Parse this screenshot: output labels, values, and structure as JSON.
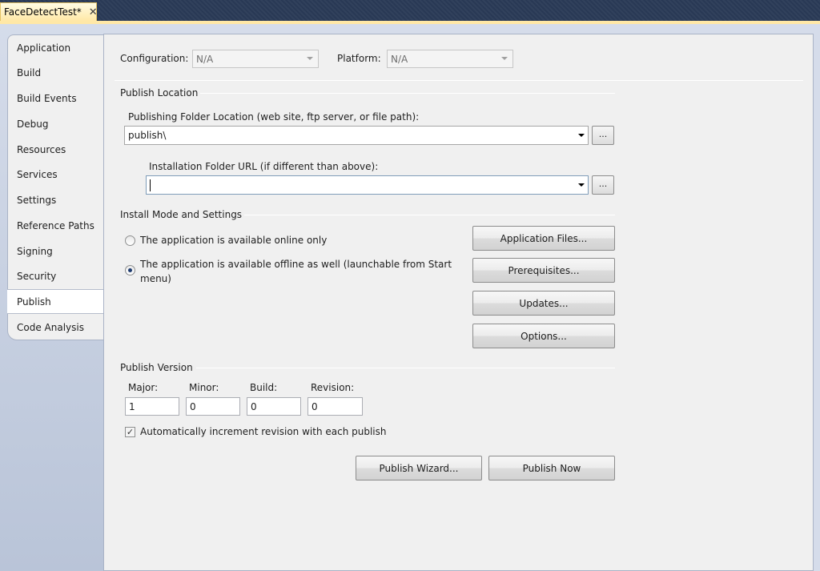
{
  "document_tab": {
    "title": "FaceDetectTest*",
    "close_glyph": "✕"
  },
  "sidebar": {
    "items": [
      {
        "label": "Application"
      },
      {
        "label": "Build"
      },
      {
        "label": "Build Events"
      },
      {
        "label": "Debug"
      },
      {
        "label": "Resources"
      },
      {
        "label": "Services"
      },
      {
        "label": "Settings"
      },
      {
        "label": "Reference Paths"
      },
      {
        "label": "Signing"
      },
      {
        "label": "Security"
      },
      {
        "label": "Publish"
      },
      {
        "label": "Code Analysis"
      }
    ],
    "active": "Publish"
  },
  "config": {
    "configuration_label": "Configuration:",
    "configuration_value": "N/A",
    "platform_label": "Platform:",
    "platform_value": "N/A"
  },
  "publish_location": {
    "title": "Publish Location",
    "folder_label": "Publishing Folder Location (web site, ftp server, or file path):",
    "folder_value": "publish\\",
    "install_label": "Installation Folder URL (if different than above):",
    "install_value": "",
    "browse_label": "..."
  },
  "install_mode": {
    "title": "Install Mode and Settings",
    "option_online": "The application is available online only",
    "option_offline": "The application is available offline as well (launchable from Start menu)",
    "selected": "offline",
    "buttons": {
      "application_files": "Application Files...",
      "prerequisites": "Prerequisites...",
      "updates": "Updates...",
      "options": "Options..."
    }
  },
  "publish_version": {
    "title": "Publish Version",
    "major_label": "Major:",
    "minor_label": "Minor:",
    "build_label": "Build:",
    "revision_label": "Revision:",
    "major": "1",
    "minor": "0",
    "build": "0",
    "revision": "0",
    "auto_increment_label": "Automatically increment revision with each publish",
    "auto_increment": true
  },
  "actions": {
    "wizard": "Publish Wizard...",
    "now": "Publish Now"
  }
}
